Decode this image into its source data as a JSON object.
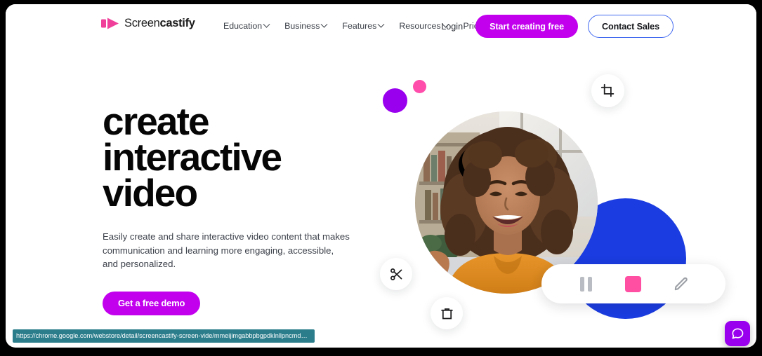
{
  "browser": {
    "status_url": "https://chrome.google.com/webstore/detail/screencastify-screen-vide/mmeijimgabbpbgpdklnllpncmdofkcpn"
  },
  "nav": {
    "brand": {
      "name_light": "Screen",
      "name_bold": "castify",
      "logo_icon": "play-mark-icon"
    },
    "links": [
      {
        "label": "Education",
        "has_caret": true
      },
      {
        "label": "Business",
        "has_caret": true
      },
      {
        "label": "Features",
        "has_caret": true
      },
      {
        "label": "Resources",
        "has_caret": true
      },
      {
        "label": "Pricing",
        "has_caret": false
      }
    ],
    "login_label": "Login",
    "primary_cta": "Start creating free",
    "secondary_cta": "Contact Sales"
  },
  "hero": {
    "headline_line1": "create",
    "headline_line2": "interactive",
    "headline_line3": "video",
    "subcopy": "Easily create and share interactive video content that makes communication and learning more engaging, accessible, and personalized.",
    "cta_label": "Get a free demo"
  },
  "floating_controls": {
    "crop": "crop-icon",
    "cut": "scissors-icon",
    "trash": "trash-icon"
  },
  "recorder_toolbar": {
    "pause": "pause-icon",
    "stop": "stop-icon",
    "draw": "pencil-icon"
  },
  "chat": {
    "icon": "chat-bubble-icon"
  },
  "colors": {
    "brand_pink": "#ef3f9a",
    "accent_purple": "#c200ee",
    "dot_purple": "#9900ee",
    "dot_pink": "#ff4dac",
    "blue_circle": "#1b3ce0",
    "outline_blue": "#4169f0",
    "stop_pink": "#ff4fa3",
    "status_teal": "#2b7d8c"
  }
}
